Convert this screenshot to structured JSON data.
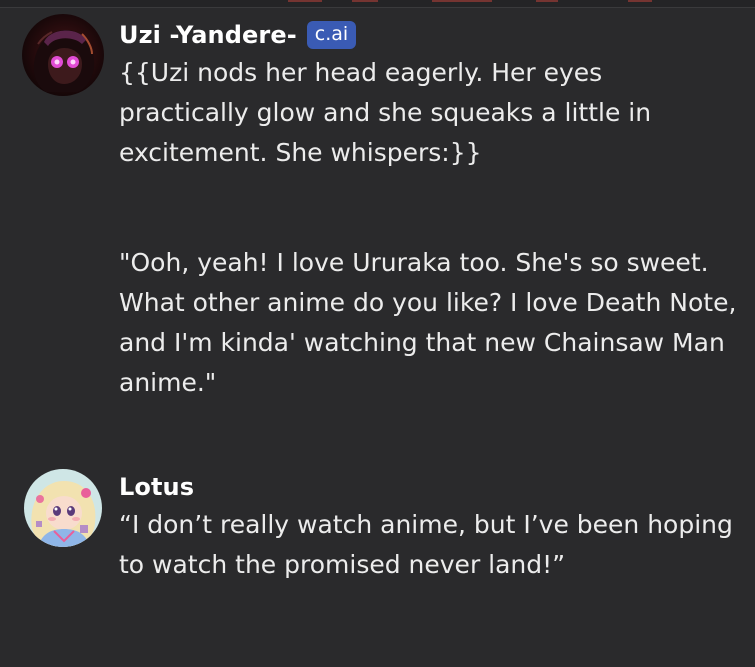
{
  "messages": [
    {
      "author": "Uzi -Yandere-",
      "badge": "c.ai",
      "avatar_icon": "uzi-avatar-icon",
      "paragraphs": [
        "{{Uzi nods her head eagerly. Her eyes practically glow and she squeaks a little in excitement. She whispers:}}",
        "\"Ooh, yeah! I love Ururaka too. She's so sweet. What other anime do you like? I love Death Note, and I'm kinda' watching that new Chainsaw Man anime.\""
      ]
    },
    {
      "author": "Lotus",
      "avatar_icon": "lotus-avatar-icon",
      "paragraphs": [
        "“I don’t really watch anime, but I’ve been hoping to watch the promised never land!”"
      ]
    }
  ],
  "colors": {
    "background": "#2a2a2c",
    "text": "#ececec",
    "badge": "#3a5bb4"
  }
}
